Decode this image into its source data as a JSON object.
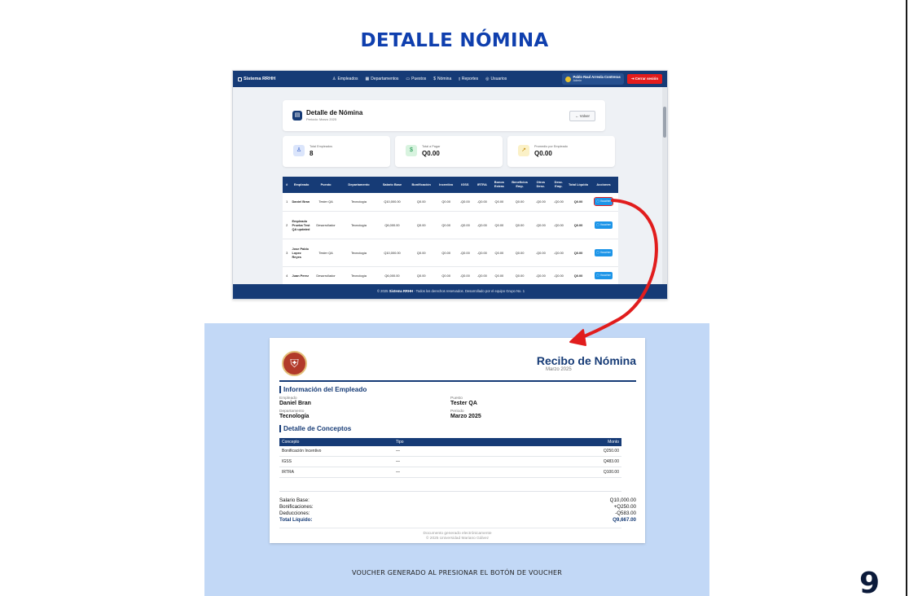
{
  "slide": {
    "title": "DETALLE NÓMINA",
    "page_number": "9",
    "caption": "VOUCHER GENERADO AL PRESIONAR EL BOTÓN DE VOUCHER"
  },
  "app": {
    "brand": "Sistema RRHH",
    "menu": [
      {
        "label": "Empleados",
        "icon": "users-icon"
      },
      {
        "label": "Departamentos",
        "icon": "building-icon"
      },
      {
        "label": "Puestos",
        "icon": "briefcase-icon"
      },
      {
        "label": "Nómina",
        "icon": "dollar-icon"
      },
      {
        "label": "Reportes",
        "icon": "chart-icon"
      },
      {
        "label": "Usuarios",
        "icon": "user-circle-icon"
      }
    ],
    "user": {
      "name": "Pablo Raul Arreola Contreras",
      "role": "Admin"
    },
    "logout_label": "Cerrar sesión",
    "header": {
      "title": "Detalle de Nómina",
      "subtitle": "Periodo: Marzo 2025",
      "back_label": "← Volver"
    },
    "stats": [
      {
        "label": "Total Empleados",
        "value": "8"
      },
      {
        "label": "Total a Pagar",
        "value": "Q0.00"
      },
      {
        "label": "Promedio por Empleado",
        "value": "Q0.00"
      }
    ],
    "table": {
      "columns": [
        "#",
        "Empleado",
        "Puesto",
        "Departamento",
        "Salario Base",
        "Bonificación",
        "Incentivo",
        "IGSS",
        "IRTRA",
        "Bonos Extras",
        "Beneficios Emp.",
        "Otros Desc.",
        "Desc. Emp.",
        "Total Líquido",
        "Acciones"
      ],
      "rows": [
        {
          "n": "1",
          "empleado": "Daniel Bran",
          "puesto": "Tester QA",
          "departamento": "Tecnología",
          "salario": "Q10,000.00",
          "bonificacion": "Q0.00",
          "incentivo": "Q0.00",
          "igss": "-Q0.00",
          "irtra": "-Q0.00",
          "bonos": "Q0.00",
          "beneficios": "Q0.00",
          "otros": "-Q0.00",
          "desc": "-Q0.00",
          "total": "Q0.00",
          "accion": "Voucher"
        },
        {
          "n": "2",
          "empleado": "Empleado Prueba Test QA updated",
          "puesto": "Desarrollador",
          "departamento": "Tecnología",
          "salario": "Q6,000.00",
          "bonificacion": "Q0.00",
          "incentivo": "Q0.00",
          "igss": "-Q0.00",
          "irtra": "-Q0.00",
          "bonos": "Q0.00",
          "beneficios": "Q0.00",
          "otros": "-Q0.00",
          "desc": "-Q0.00",
          "total": "Q0.00",
          "accion": "Voucher"
        },
        {
          "n": "3",
          "empleado": "Jose Pablo Lopez Reyes",
          "puesto": "Tester QA",
          "departamento": "Tecnología",
          "salario": "Q10,000.00",
          "bonificacion": "Q0.00",
          "incentivo": "Q0.00",
          "igss": "-Q0.00",
          "irtra": "-Q0.00",
          "bonos": "Q0.00",
          "beneficios": "Q0.00",
          "otros": "-Q0.00",
          "desc": "-Q0.00",
          "total": "Q0.00",
          "accion": "Voucher"
        },
        {
          "n": "4",
          "empleado": "Juan Perez",
          "puesto": "Desarrollador",
          "departamento": "Tecnología",
          "salario": "Q6,000.00",
          "bonificacion": "Q0.00",
          "incentivo": "Q0.00",
          "igss": "-Q0.00",
          "irtra": "-Q0.00",
          "bonos": "Q0.00",
          "beneficios": "Q0.00",
          "otros": "-Q0.00",
          "desc": "-Q0.00",
          "total": "Q0.00",
          "accion": "Voucher"
        }
      ]
    },
    "footer": {
      "prefix": "© 2025",
      "brand": "Sistema RRHH",
      "suffix": "- Todos los derechos reservados. Desarrollado por el equipo Grupo No. 1"
    }
  },
  "voucher": {
    "title": "Recibo de Nómina",
    "period": "Marzo 2025",
    "info_heading": "Información del Empleado",
    "fields": {
      "empleado_label": "Empleado",
      "empleado": "Daniel Bran",
      "puesto_label": "Puesto",
      "puesto": "Tester QA",
      "departamento_label": "Departamento",
      "departamento": "Tecnología",
      "periodo_label": "Periodo",
      "periodo": "Marzo 2025"
    },
    "concepts_heading": "Detalle de Conceptos",
    "concepts_columns": [
      "Concepto",
      "Tipo",
      "Monto"
    ],
    "concepts": [
      {
        "concepto": "Bonificación Incentivo",
        "tipo": "—",
        "monto": "Q250.00"
      },
      {
        "concepto": "IGSS",
        "tipo": "—",
        "monto": "Q483.00"
      },
      {
        "concepto": "IRTRA",
        "tipo": "—",
        "monto": "Q100.00"
      }
    ],
    "summary": [
      {
        "label": "Salario Base:",
        "value": "Q10,000.00"
      },
      {
        "label": "Bonificaciones:",
        "value": "+Q250.00"
      },
      {
        "label": "Deducciones:",
        "value": "-Q583.00"
      },
      {
        "label": "Total Líquido:",
        "value": "Q9,667.00"
      }
    ],
    "footer_line1": "Documento generado electrónicamente",
    "footer_line2": "© 2025 Universidad Mariano Gálvez"
  },
  "colors": {
    "brand_navy": "#163b76",
    "title_blue": "#0f3fae",
    "panel_blue": "#c2d8f6",
    "danger": "#e41c1c",
    "voucher_button": "#1d95e8",
    "arrow": "#e11d1d"
  }
}
